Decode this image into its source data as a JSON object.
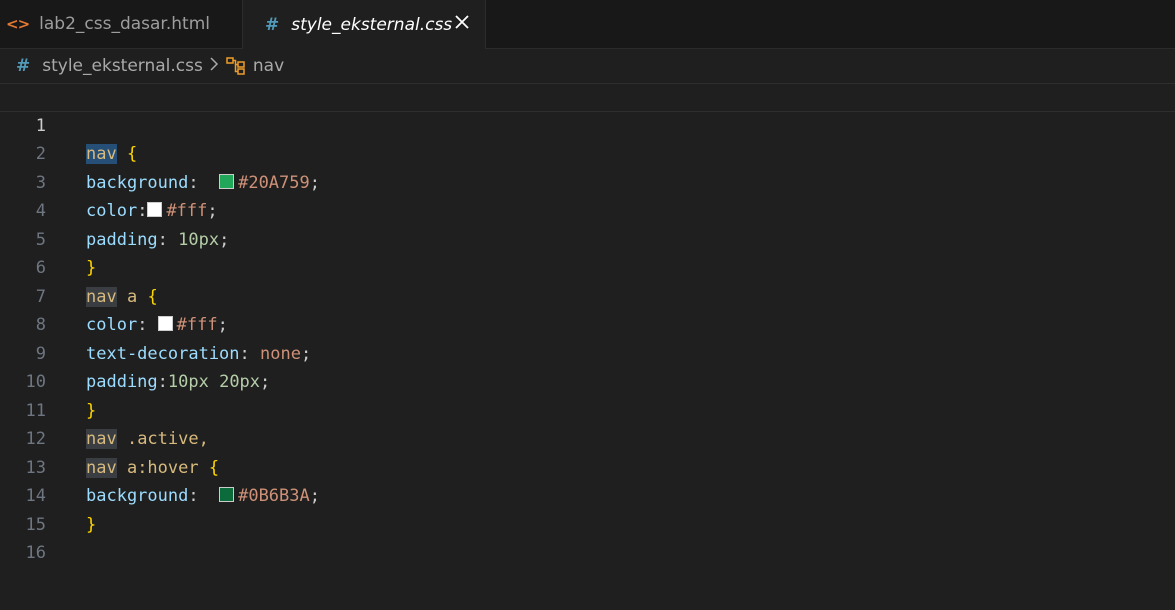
{
  "tabs": [
    {
      "label": "lab2_css_dasar.html",
      "icon": "html-icon"
    },
    {
      "label": "style_eksternal.css",
      "icon": "css-icon"
    }
  ],
  "breadcrumb": {
    "file": "style_eksternal.css",
    "symbol": "nav"
  },
  "colors": {
    "swatch_green_1": "#20A759",
    "swatch_white": "#fff",
    "swatch_green_2": "#0B6B3A",
    "accent": "#d7ba7d"
  },
  "lines": {
    "l1": {
      "num": "1",
      "sel": "nav",
      "brace": "{"
    },
    "l2": {
      "num": "2",
      "prop": "background",
      "colon": ": ",
      "value": "#20A759",
      "semi": ";"
    },
    "l3": {
      "num": "3",
      "prop": "color",
      "colon": ":",
      "value": "#fff",
      "semi": ";"
    },
    "l4": {
      "num": "4",
      "prop": "padding",
      "colon": ": ",
      "value": "10px",
      "semi": ";"
    },
    "l5": {
      "num": "5",
      "brace": "}"
    },
    "l6": {
      "num": "6",
      "sel": "nav",
      "rest": " a ",
      "brace": "{"
    },
    "l7": {
      "num": "7",
      "prop": "color",
      "colon": ": ",
      "value": "#fff",
      "semi": ";"
    },
    "l8": {
      "num": "8",
      "prop": "text-decoration",
      "colon": ": ",
      "value": "none",
      "semi": ";"
    },
    "l9": {
      "num": "9",
      "prop": "padding",
      "colon": ":",
      "value": "10px 20px",
      "semi": ";"
    },
    "l10": {
      "num": "10",
      "brace": "}"
    },
    "l11": {
      "num": "11",
      "sel": "nav",
      "rest": " .active,"
    },
    "l12": {
      "num": "12",
      "sel": "nav",
      "rest": " a:hover ",
      "brace": "{"
    },
    "l13": {
      "num": "13",
      "prop": "background",
      "colon": ": ",
      "value": "#0B6B3A",
      "semi": ";"
    },
    "l14": {
      "num": "14",
      "brace": "}"
    },
    "l15": {
      "num": "15"
    },
    "l16": {
      "num": "16"
    }
  }
}
